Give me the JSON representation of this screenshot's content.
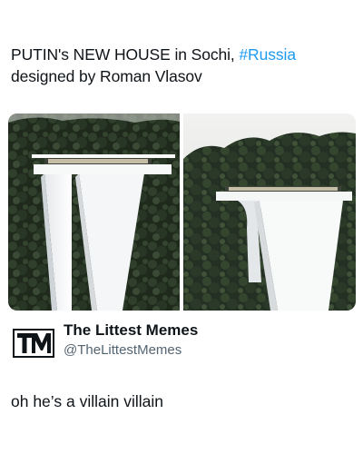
{
  "post": {
    "line1": "PUTIN's NEW HOUSE in Sochi, ",
    "hashtag": "#Russia",
    "line2": "designed by Roman Vlasov"
  },
  "quoted_account": {
    "logo_text": "TM",
    "name": "The Littest Memes",
    "handle": "@TheLittestMemes"
  },
  "caption": "oh he’s a villain villain",
  "colors": {
    "hashtag": "#1d9bf0",
    "handle": "#536471",
    "text": "#0f1419"
  }
}
